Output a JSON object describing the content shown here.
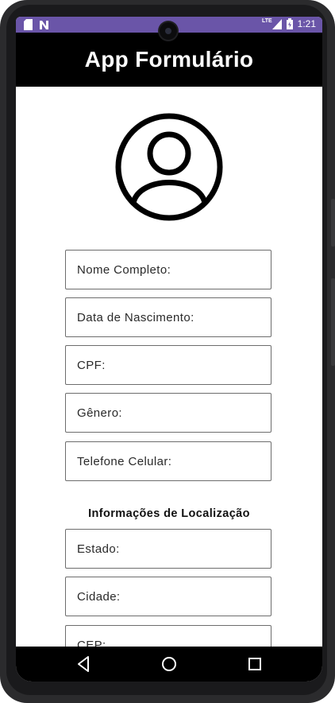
{
  "status_bar": {
    "background": "#6a55a8",
    "left_icons": [
      "sd-card-icon",
      "n-notification-icon"
    ],
    "network_label": "LTE",
    "time": "1:21"
  },
  "app_bar": {
    "title": "App Formulário",
    "background": "#000000"
  },
  "avatar": {
    "icon": "account-circle-icon"
  },
  "personal_fields": [
    {
      "label": "Nome Completo:"
    },
    {
      "label": "Data de Nascimento:"
    },
    {
      "label": "CPF:"
    },
    {
      "label": "Gênero:"
    },
    {
      "label": "Telefone Celular:"
    }
  ],
  "location_section": {
    "title": "Informações de Localização",
    "fields": [
      {
        "label": "Estado:"
      },
      {
        "label": "Cidade:"
      },
      {
        "label": "CEP:"
      }
    ]
  },
  "nav_bar": {
    "buttons": [
      "back-icon",
      "home-icon",
      "recents-icon"
    ]
  }
}
